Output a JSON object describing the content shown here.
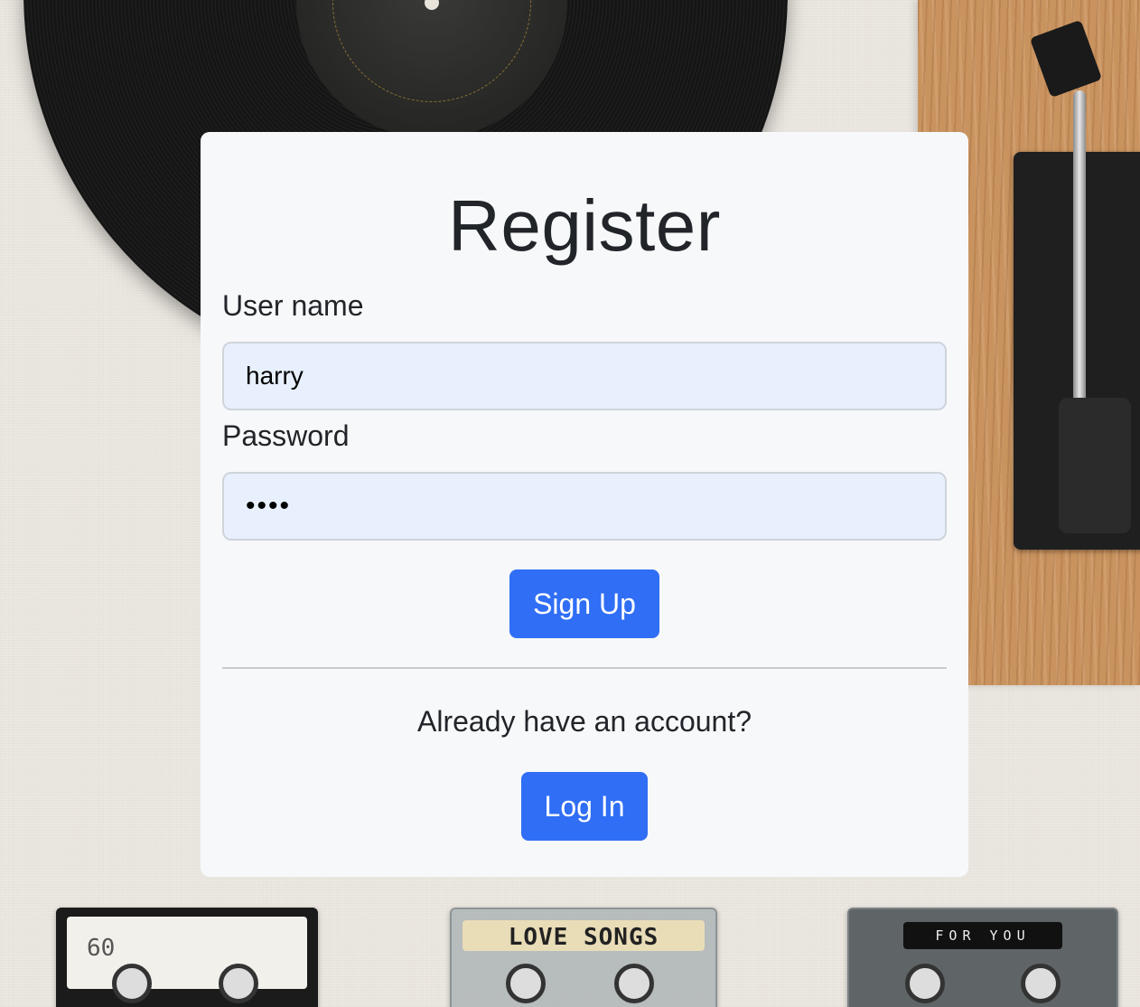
{
  "form": {
    "title": "Register",
    "username_label": "User name",
    "username_value": "harry",
    "password_label": "Password",
    "password_value": "1234",
    "signup_label": "Sign Up",
    "account_prompt": "Already have an account?",
    "login_label": "Log In"
  },
  "background": {
    "cassettes": [
      {
        "label": "60"
      },
      {
        "label": "LOVE SONGS"
      },
      {
        "label": "FOR YOU"
      }
    ]
  },
  "colors": {
    "primary_button": "#2f6ef5",
    "card_background": "#f7f8fa",
    "input_background": "#e8f0fe",
    "text": "#212529"
  }
}
